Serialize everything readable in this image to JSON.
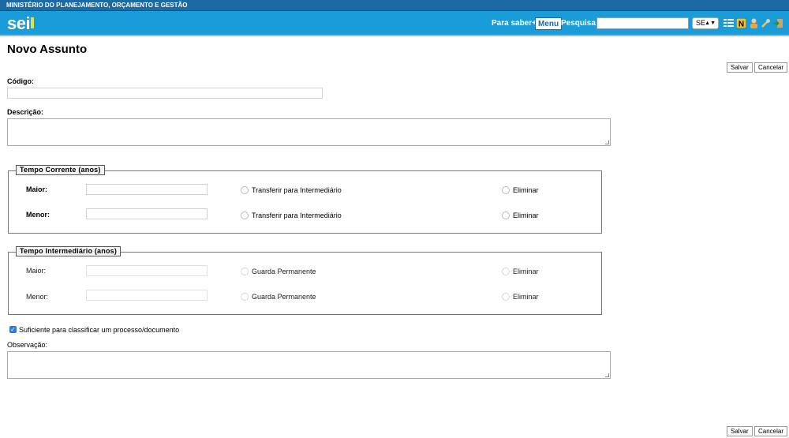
{
  "header": {
    "org": "MINISTÉRIO DO PLANEJAMENTO, ORÇAMENTO E GESTÃO",
    "logo": "sei",
    "para_saber": "Para saber+",
    "menu": "Menu",
    "pesquisa": "Pesquisa",
    "search_value": "",
    "unit_select": "SE",
    "icons": [
      "list-icon",
      "notification-icon",
      "user-icon",
      "tools-icon",
      "exit-icon"
    ]
  },
  "form": {
    "title": "Novo Assunto",
    "save": "Salvar",
    "cancel": "Cancelar",
    "codigo_label": "Código:",
    "codigo_value": "",
    "descricao_label": "Descrição:",
    "descricao_value": "",
    "tempo_corrente": {
      "legend": "Tempo Corrente (anos)",
      "maior_label": "Maior:",
      "menor_label": "Menor:",
      "maior_value": "",
      "menor_value": "",
      "transfer_label": "Transferir para Intermediário",
      "eliminar_label": "Eliminar"
    },
    "tempo_intermediario": {
      "legend": "Tempo Intermediário (anos)",
      "maior_label": "Maior:",
      "menor_label": "Menor:",
      "maior_value": "",
      "menor_value": "",
      "guarda_label": "Guarda Permanente",
      "eliminar_label": "Eliminar"
    },
    "suficiente_label": "Suficiente para classificar um processo/documento",
    "suficiente_checked": true,
    "observacao_label": "Observação:",
    "observacao_value": ""
  },
  "colors": {
    "topbar": "#1b6aa4",
    "navbar": "#1a9cd8",
    "checkbox": "#2d7cd6"
  }
}
